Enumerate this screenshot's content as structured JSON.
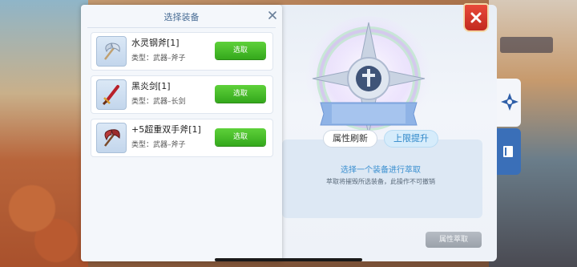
{
  "select_panel": {
    "title": "选择装备",
    "items": [
      {
        "name": "水灵钢斧[1]",
        "type": "类型：武器–斧子",
        "button": "选取",
        "icon": "axe-icon"
      },
      {
        "name": "黑炎剑[1]",
        "type": "类型：武器–长剑",
        "button": "选取",
        "icon": "sword-icon"
      },
      {
        "name": "+5超重双手斧[1]",
        "type": "类型：武器–斧子",
        "button": "选取",
        "icon": "double-axe-icon"
      }
    ]
  },
  "main_panel": {
    "tab_refresh": "属性刷新",
    "tab_upgrade": "上限提升",
    "hint_title": "选择一个装备进行萃取",
    "hint_sub": "萃取将摧毁所选装备，此操作不可撤销",
    "extract_button": "属性萃取"
  },
  "colors": {
    "select_button": "#3fb824",
    "hint_title": "#3a8fd0",
    "close_button": "#d8382a",
    "side_tab_book": "#3a6fb8"
  }
}
